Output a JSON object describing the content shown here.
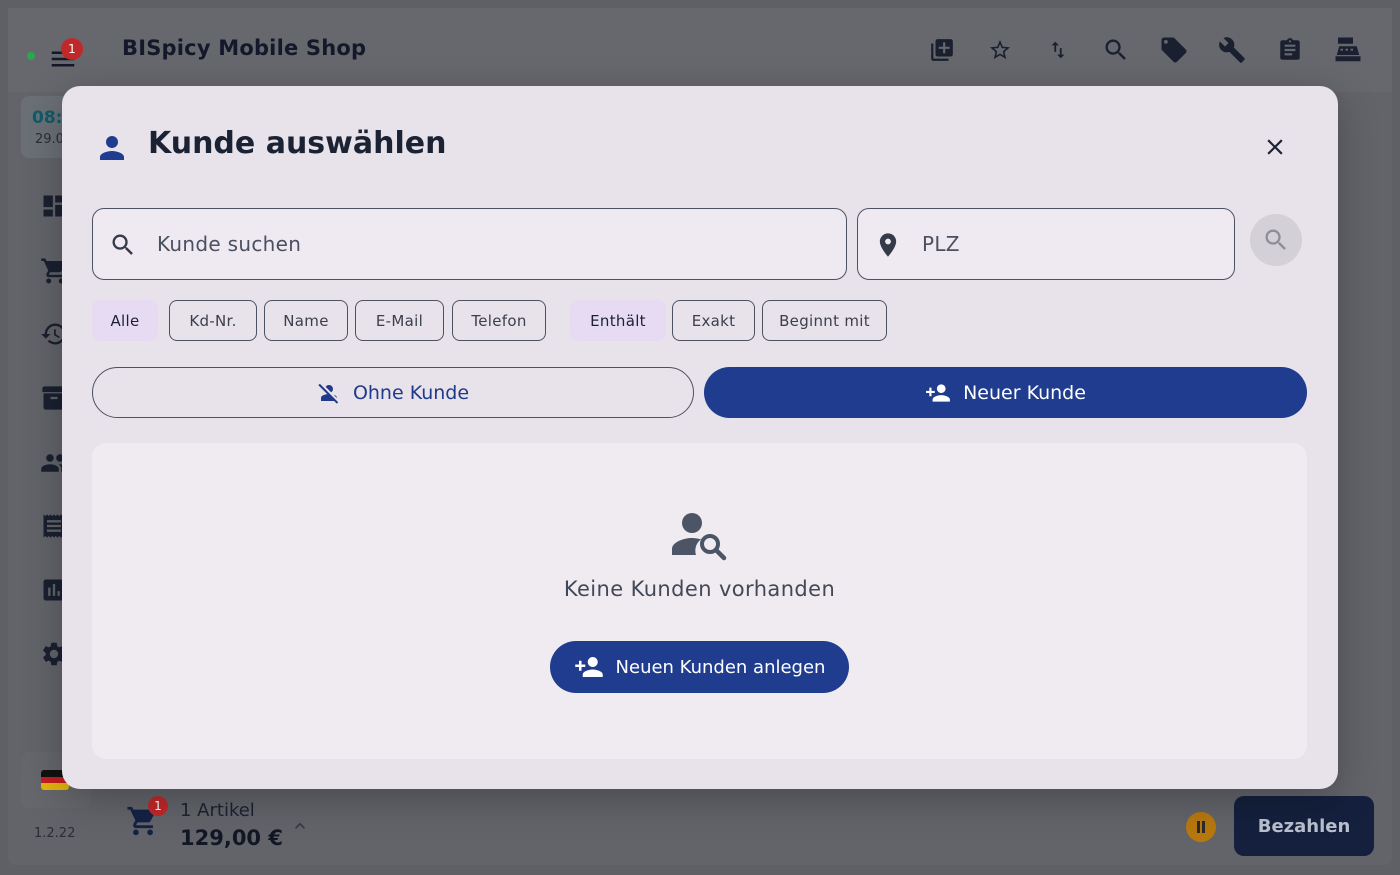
{
  "app": {
    "title": "BISpicy Mobile Shop",
    "menu_badge": "1",
    "time": "08:1",
    "date": "29.0",
    "version": "1.2.22"
  },
  "top_icons": [
    "add-box-icon",
    "star-outline-icon",
    "swap-vertical-icon",
    "search-icon",
    "tag-icon",
    "wrench-icon",
    "clipboard-icon",
    "cash-register-icon"
  ],
  "sidebar_icons": [
    "dashboard-icon",
    "cart-icon",
    "history-icon",
    "archive-icon",
    "people-icon",
    "receipt-icon",
    "bar-chart-icon",
    "gear-icon"
  ],
  "cart": {
    "badge": "1",
    "count_label": "1 Artikel",
    "total": "129,00 €",
    "pay_label": "Bezahlen"
  },
  "modal": {
    "title": "Kunde auswählen",
    "search_placeholder": "Kunde suchen",
    "plz_placeholder": "PLZ",
    "field_filters": [
      {
        "label": "Alle",
        "selected": true
      },
      {
        "label": "Kd-Nr.",
        "selected": false
      },
      {
        "label": "Name",
        "selected": false
      },
      {
        "label": "E-Mail",
        "selected": false
      },
      {
        "label": "Telefon",
        "selected": false
      }
    ],
    "match_filters": [
      {
        "label": "Enthält",
        "selected": true
      },
      {
        "label": "Exakt",
        "selected": false
      },
      {
        "label": "Beginnt mit",
        "selected": false
      }
    ],
    "no_customer_label": "Ohne Kunde",
    "new_customer_label": "Neuer Kunde",
    "empty_text": "Keine Kunden vorhanden",
    "create_customer_label": "Neuen Kunden anlegen"
  },
  "colors": {
    "primary": "#1f3c8f",
    "chip_selected": "#e7dbf3",
    "modal_bg": "#e8e2ea",
    "badge": "#c0282a"
  }
}
